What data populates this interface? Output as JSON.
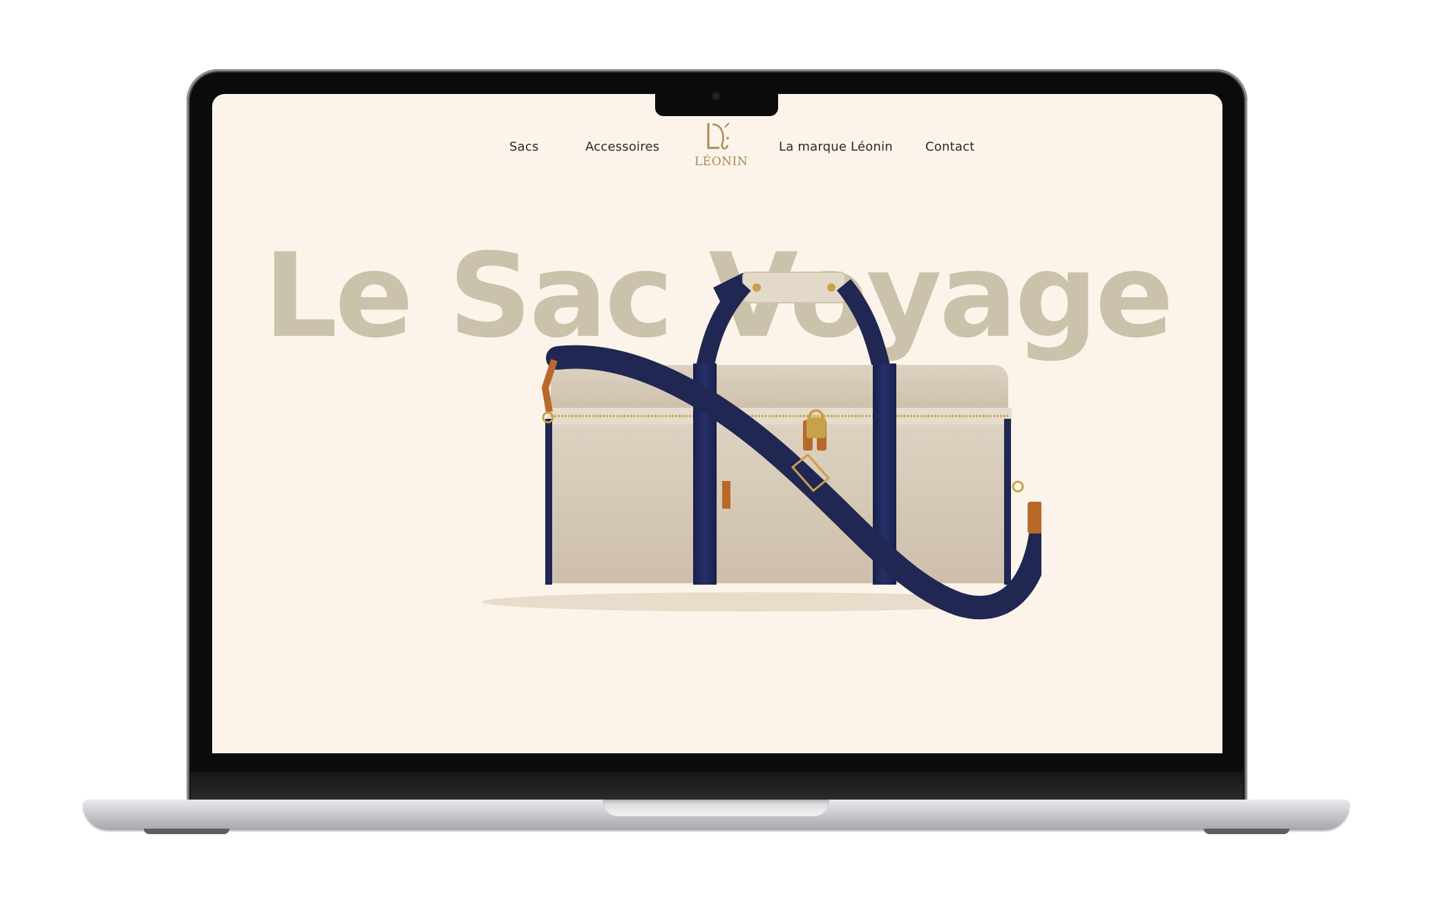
{
  "nav": {
    "items": [
      {
        "label": "Sacs"
      },
      {
        "label": "Accessoires"
      },
      {
        "label": "La marque Léonin"
      },
      {
        "label": "Contact"
      }
    ],
    "logo": {
      "wordmark": "LÉONIN",
      "monogram-icon": "leonin-monogram-icon"
    }
  },
  "hero": {
    "title": "Le Sac Voyage"
  },
  "colors": {
    "background": "#fcf4ea",
    "title": "#cbc2ac",
    "bag_canvas": "#d6cab8",
    "strap_navy": "#1f2752",
    "leather": "#b8692a",
    "gold": "#c9a14a"
  }
}
